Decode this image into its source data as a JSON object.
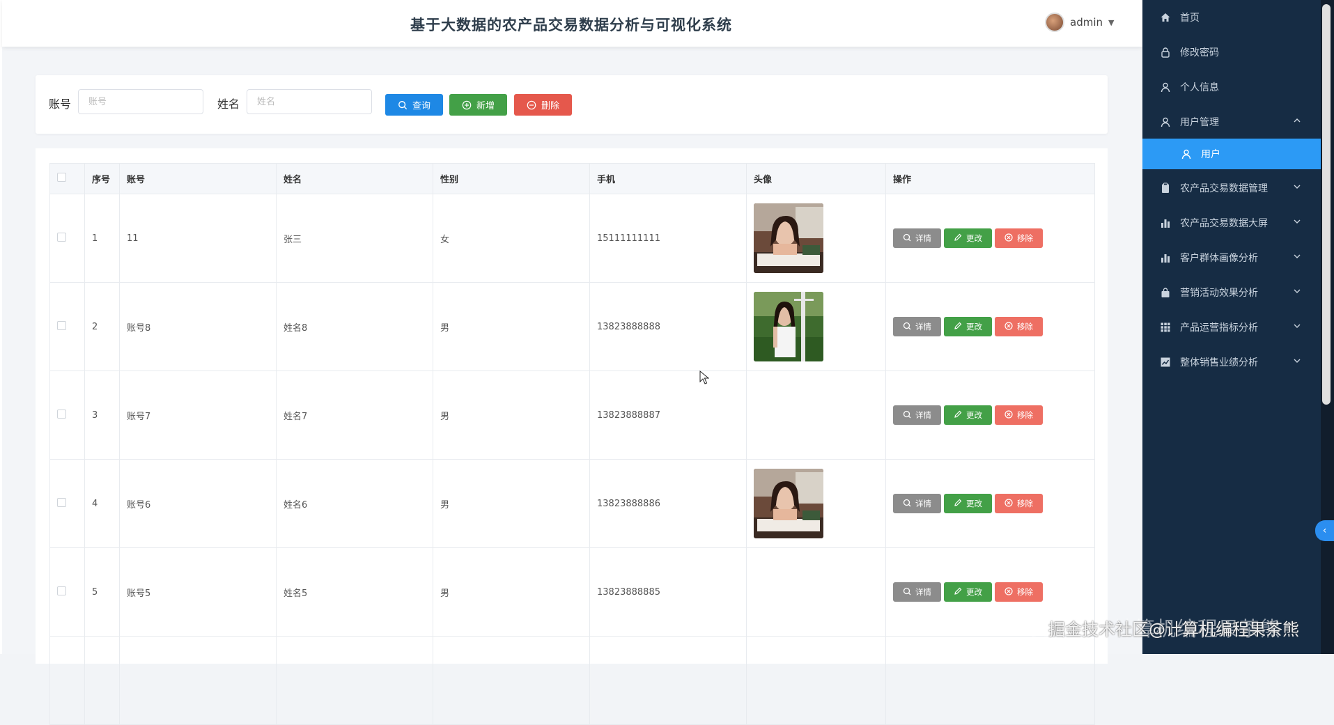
{
  "header": {
    "title": "基于大数据的农产品交易数据分析与可视化系统",
    "user": "admin"
  },
  "search": {
    "account_label": "账号",
    "account_placeholder": "账号",
    "name_label": "姓名",
    "name_placeholder": "姓名",
    "query_label": "查询",
    "add_label": "新增",
    "delete_label": "删除"
  },
  "table": {
    "headers": [
      "序号",
      "账号",
      "姓名",
      "性别",
      "手机",
      "头像",
      "操作"
    ],
    "rows": [
      {
        "index": "1",
        "account": "11",
        "name": "张三",
        "gender": "女",
        "phone": "15111111111",
        "avatar": "photo-girl-desk"
      },
      {
        "index": "2",
        "account": "账号8",
        "name": "姓名8",
        "gender": "男",
        "phone": "13823888888",
        "avatar": "photo-girl-outdoor"
      },
      {
        "index": "3",
        "account": "账号7",
        "name": "姓名7",
        "gender": "男",
        "phone": "13823888887",
        "avatar": ""
      },
      {
        "index": "4",
        "account": "账号6",
        "name": "姓名6",
        "gender": "男",
        "phone": "13823888886",
        "avatar": "photo-girl-desk"
      },
      {
        "index": "5",
        "account": "账号5",
        "name": "姓名5",
        "gender": "男",
        "phone": "13823888885",
        "avatar": ""
      }
    ],
    "ops": {
      "detail": "详情",
      "edit": "更改",
      "remove": "移除"
    }
  },
  "sidebar": {
    "items": [
      {
        "label": "首页",
        "icon": "home-icon"
      },
      {
        "label": "修改密码",
        "icon": "lock-icon"
      },
      {
        "label": "个人信息",
        "icon": "user-icon"
      },
      {
        "label": "用户管理",
        "icon": "user-icon"
      },
      {
        "label": "用户",
        "icon": "user-icon"
      },
      {
        "label": "农产品交易数据管理",
        "icon": "clipboard-icon"
      },
      {
        "label": "农产品交易数据大屏",
        "icon": "bar-chart-icon"
      },
      {
        "label": "客户群体画像分析",
        "icon": "bar-chart-icon"
      },
      {
        "label": "营销活动效果分析",
        "icon": "bag-icon"
      },
      {
        "label": "产品运营指标分析",
        "icon": "grid-icon"
      },
      {
        "label": "整体销售业绩分析",
        "icon": "line-chart-icon"
      }
    ]
  },
  "watermark": "掘金技术社区@计算机编程果茶熊",
  "watermark_bg": "CSDN @计算机编程果茶熊",
  "colors": {
    "primary": "#1e88e5",
    "success": "#43a047",
    "danger": "#e5584c",
    "sidebar": "#162c44",
    "active": "#2c9af5"
  }
}
